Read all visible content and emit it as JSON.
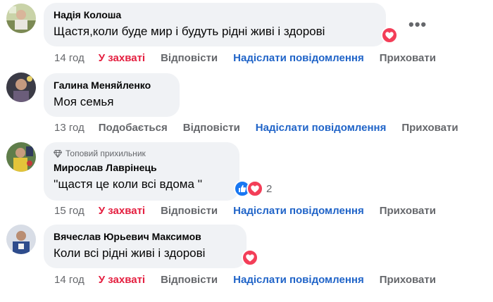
{
  "colors": {
    "bubble": "#f0f2f5",
    "muted": "#65676b",
    "love": "#e41e3f",
    "link": "#2064c8",
    "heart": "#f33e58",
    "like": "#1877f2"
  },
  "comments": [
    {
      "author": "Надія Колоша",
      "text": "Щастя,коли буде мир і будуть рідні живі і здорові",
      "reactions": [
        "heart"
      ],
      "time": "14 год",
      "reaction_label": "У захваті",
      "reply": "Відповісти",
      "message": "Надіслати повідомлення",
      "hide": "Приховати",
      "more": "•••"
    },
    {
      "author": "Галина Меняйленко",
      "text": "Моя семья",
      "time": "13 год",
      "reaction_label": "Подобається",
      "reply": "Відповісти",
      "message": "Надіслати повідомлення",
      "hide": "Приховати"
    },
    {
      "badge": "Топовий прихильник",
      "author": "Мирослав Лаврінець",
      "text": "''щастя це коли всі вдома ''",
      "reactions": [
        "like",
        "heart"
      ],
      "reaction_count": "2",
      "time": "15 год",
      "reaction_label": "У захваті",
      "reply": "Відповісти",
      "message": "Надіслати повідомлення",
      "hide": "Приховати"
    },
    {
      "author": "Вячеслав Юрьевич Максимов",
      "text": "Коли всі рідні живі і здорові",
      "reactions": [
        "heart"
      ],
      "time": "14 год",
      "reaction_label": "У захваті",
      "reply": "Відповісти",
      "message": "Надіслати повідомлення",
      "hide": "Приховати"
    }
  ]
}
